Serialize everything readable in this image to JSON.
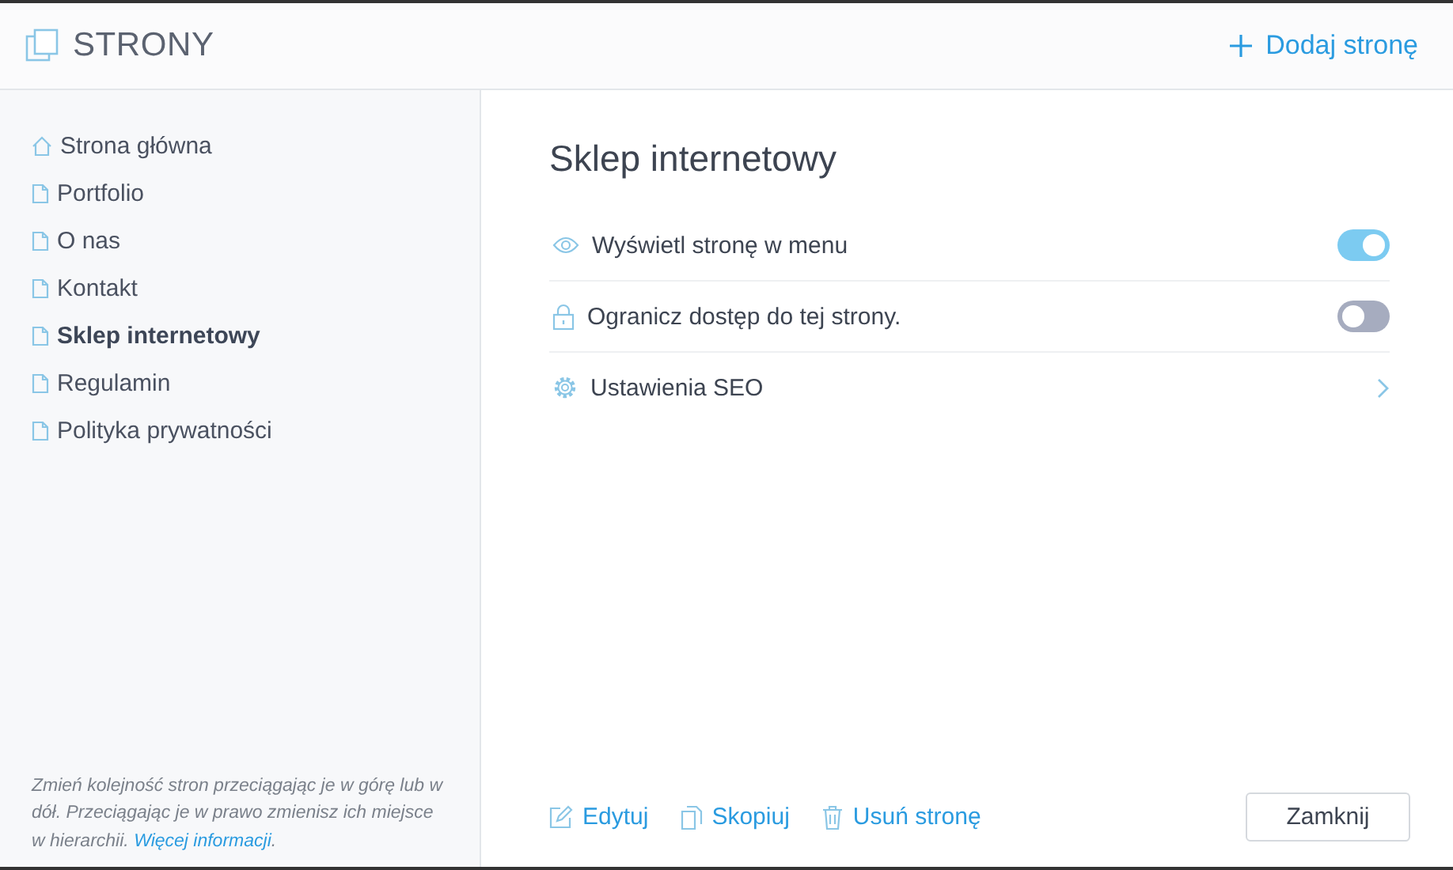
{
  "header": {
    "title": "STRONY",
    "add_button": "Dodaj stronę"
  },
  "sidebar": {
    "items": [
      {
        "label": "Strona główna",
        "kind": "home",
        "selected": false
      },
      {
        "label": "Portfolio",
        "kind": "page",
        "selected": false
      },
      {
        "label": "O nas",
        "kind": "page",
        "selected": false
      },
      {
        "label": "Kontakt",
        "kind": "page",
        "selected": false
      },
      {
        "label": "Sklep internetowy",
        "kind": "page",
        "selected": true
      },
      {
        "label": "Regulamin",
        "kind": "page",
        "selected": false
      },
      {
        "label": "Polityka prywatności",
        "kind": "page",
        "selected": false
      }
    ],
    "hint": "Zmień kolejność stron przeciągając je w górę lub w dół. Przeciągając je w prawo zmienisz ich miejsce w hierarchii.",
    "hint_link": "Więcej informacji",
    "hint_tail": "."
  },
  "panel": {
    "title": "Sklep internetowy",
    "settings": [
      {
        "label": "Wyświetl stronę w menu",
        "kind": "toggle",
        "on": true
      },
      {
        "label": "Ogranicz dostęp do tej strony.",
        "kind": "toggle",
        "on": false
      },
      {
        "label": "Ustawienia SEO",
        "kind": "link"
      }
    ],
    "actions": [
      "Edytuj",
      "Skopiuj",
      "Usuń stronę"
    ],
    "close_button": "Zamknij"
  }
}
